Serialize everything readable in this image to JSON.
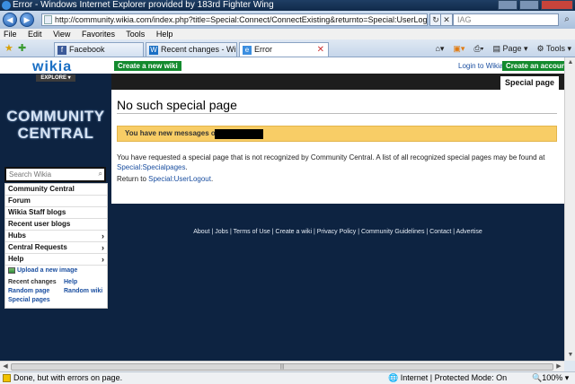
{
  "window": {
    "title": "Error - Windows Internet Explorer provided by 183rd Fighter Wing"
  },
  "address": {
    "url": "http://community.wikia.com/index.php?title=Special:Connect/ConnectExisting&returnto=Special:UserLogout&returntoquery=returnt",
    "search_value": "IAG"
  },
  "menu": [
    "File",
    "Edit",
    "View",
    "Favorites",
    "Tools",
    "Help"
  ],
  "tabs": [
    {
      "label": "Facebook",
      "icon": "facebook-icon"
    },
    {
      "label": "Recent changes - Wikia Co...",
      "icon": "wikia-icon"
    },
    {
      "label": "Error",
      "icon": "ie-page-icon"
    }
  ],
  "command_bar": {
    "page_label": "Page",
    "tools_label": "Tools"
  },
  "header": {
    "create_wiki": "Create a new wiki",
    "login": "Login to Wikia",
    "create_account": "Create an account"
  },
  "sidebar": {
    "logo": "wikia",
    "explore": "EXPLORE",
    "wiki_name_line1": "COMMUNITY",
    "wiki_name_line2": "CENTRAL",
    "search_placeholder": "Search Wikia",
    "nav_items": [
      {
        "label": "Community Central",
        "has_submenu": false
      },
      {
        "label": "Forum",
        "has_submenu": false
      },
      {
        "label": "Wikia Staff blogs",
        "has_submenu": false
      },
      {
        "label": "Recent user blogs",
        "has_submenu": false
      },
      {
        "label": "Hubs",
        "has_submenu": true
      },
      {
        "label": "Central Requests",
        "has_submenu": true
      },
      {
        "label": "Help",
        "has_submenu": true
      }
    ],
    "upload": "Upload a new image",
    "links": [
      "Recent changes",
      "Help",
      "Random page",
      "Random wiki",
      "Special pages"
    ]
  },
  "content": {
    "tab": "Special page",
    "title": "No such special page",
    "new_messages": "You have new messages on",
    "body": "You have requested a special page that is not recognized by Community Central. A list of all recognized special pages may be found at",
    "body_link": "Special:Specialpages",
    "body_end": ".",
    "return_prefix": "Return to",
    "return_link": "Special:UserLogout",
    "return_end": "."
  },
  "footer": [
    "About",
    "Jobs",
    "Terms of Use",
    "Create a wiki",
    "Privacy Policy",
    "Community Guidelines",
    "Contact",
    "Advertise"
  ],
  "statusbar": {
    "left": "Done, but with errors on page.",
    "zone": "Internet | Protected Mode: On",
    "zoom": "100%"
  }
}
